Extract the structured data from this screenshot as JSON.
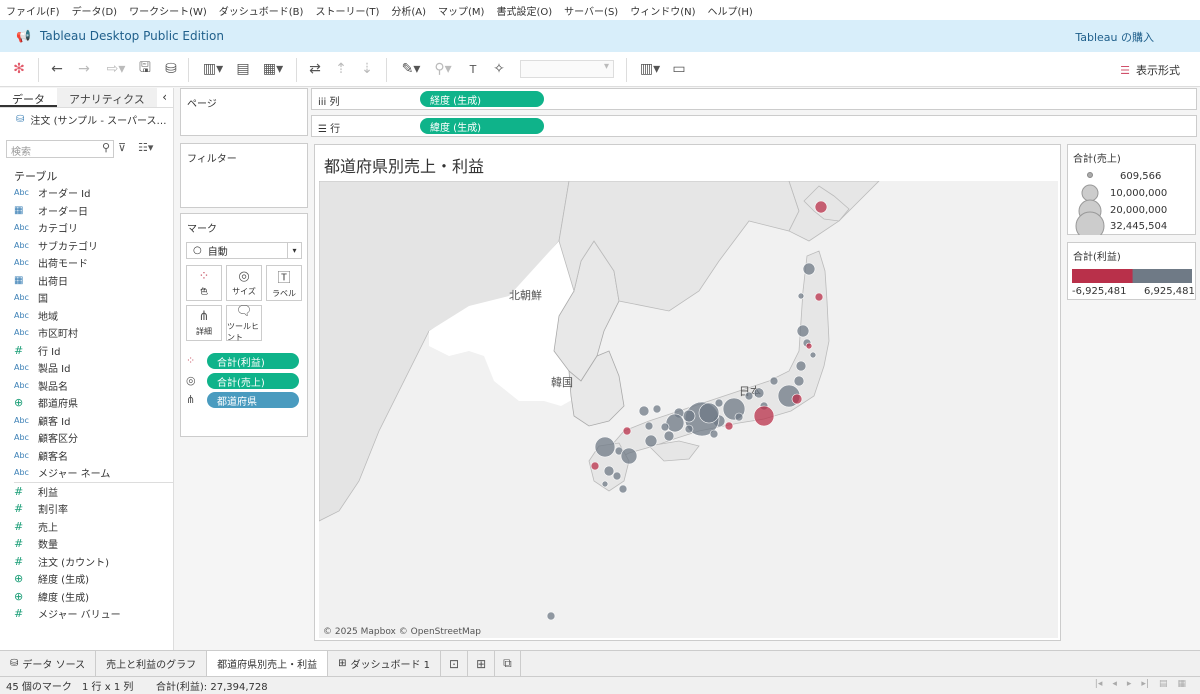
{
  "menu": [
    "ファイル(F)",
    "データ(D)",
    "ワークシート(W)",
    "ダッシュボード(B)",
    "ストーリー(T)",
    "分析(A)",
    "マップ(M)",
    "書式設定(O)",
    "サーバー(S)",
    "ウィンドウ(N)",
    "ヘルプ(H)"
  ],
  "banner": {
    "title": "Tableau Desktop Public Edition",
    "buy": "Tableau の購入"
  },
  "toolbar": {
    "show_me": "表示形式"
  },
  "data_pane": {
    "tab_data": "データ",
    "tab_analytics": "アナリティクス",
    "source": "注文 (サンプル - スーパース…",
    "search_placeholder": "検索",
    "table_header": "テーブル",
    "fields": [
      {
        "type": "Abc",
        "name": "オーダー Id"
      },
      {
        "type": "date",
        "name": "オーダー日"
      },
      {
        "type": "Abc",
        "name": "カテゴリ"
      },
      {
        "type": "Abc",
        "name": "サブカテゴリ"
      },
      {
        "type": "Abc",
        "name": "出荷モード"
      },
      {
        "type": "date",
        "name": "出荷日"
      },
      {
        "type": "Abc",
        "name": "国"
      },
      {
        "type": "Abc",
        "name": "地域"
      },
      {
        "type": "Abc",
        "name": "市区町村"
      },
      {
        "type": "#",
        "name": "行 Id"
      },
      {
        "type": "Abc",
        "name": "製品 Id"
      },
      {
        "type": "Abc",
        "name": "製品名"
      },
      {
        "type": "geo",
        "name": "都道府県"
      },
      {
        "type": "Abc",
        "name": "顧客 Id"
      },
      {
        "type": "Abc",
        "name": "顧客区分"
      },
      {
        "type": "Abc",
        "name": "顧客名"
      },
      {
        "type": "Abc",
        "name": "メジャー ネーム"
      }
    ],
    "measures": [
      {
        "type": "#",
        "name": "利益"
      },
      {
        "type": "#",
        "name": "割引率"
      },
      {
        "type": "#",
        "name": "売上"
      },
      {
        "type": "#",
        "name": "数量"
      },
      {
        "type": "#",
        "name": "注文 (カウント)"
      },
      {
        "type": "geo",
        "name": "経度 (生成)"
      },
      {
        "type": "geo",
        "name": "緯度 (生成)"
      },
      {
        "type": "#",
        "name": "メジャー バリュー"
      }
    ]
  },
  "cards": {
    "pages": "ページ",
    "filters": "フィルター",
    "marks": "マーク",
    "mark_type": "自動",
    "buttons": [
      "色",
      "サイズ",
      "ラベル",
      "詳細",
      "ツールヒント"
    ],
    "pills": [
      "合計(利益)",
      "合計(売上)",
      "都道府県"
    ]
  },
  "shelves": {
    "columns_label": "列",
    "columns_pill": "経度 (生成)",
    "rows_label": "行",
    "rows_pill": "緯度 (生成)"
  },
  "view": {
    "title": "都道府県別売上・利益",
    "labels": {
      "north_korea": "北朝鮮",
      "korea": "韓国",
      "japan": "日本"
    },
    "credit": "© 2025 Mapbox © OpenStreetMap"
  },
  "legend_size": {
    "title": "合計(売上)",
    "values": [
      "609,566",
      "10,000,000",
      "20,000,000",
      "32,445,504"
    ]
  },
  "legend_color": {
    "title": "合計(利益)",
    "min": "-6,925,481",
    "max": "6,925,481",
    "colors": {
      "negative": "#b9304a",
      "positive": "#6f7a86"
    }
  },
  "sheet_tabs": {
    "data_source": "データ ソース",
    "tabs": [
      "売上と利益のグラフ",
      "都道府県別売上・利益",
      "ダッシュボード 1"
    ]
  },
  "status": {
    "marks": "45 個のマーク",
    "rows_cols": "1 行 x 1 列",
    "sum": "合計(利益): 27,394,728"
  }
}
